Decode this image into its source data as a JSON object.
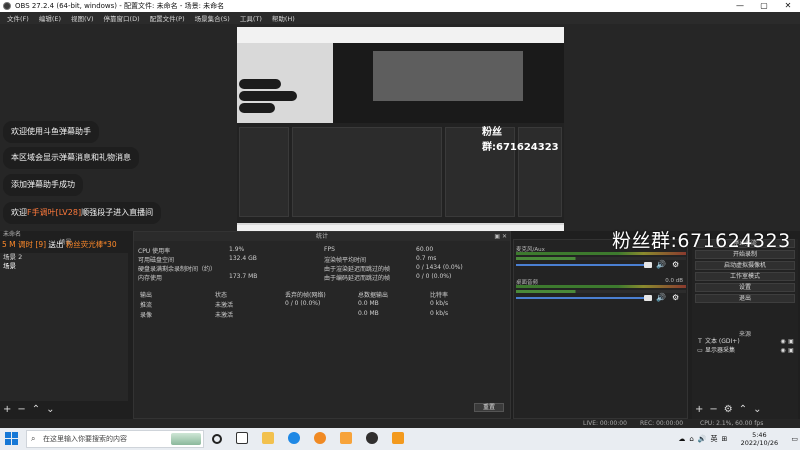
{
  "window": {
    "title": "OBS 27.2.4 (64-bit, windows) - 配置文件: 未命名 - 场景: 未命名",
    "controls": [
      "—",
      "▢",
      "✕"
    ]
  },
  "menu": [
    "文件(F)",
    "编辑(E)",
    "视图(V)",
    "停靠窗口(D)",
    "配置文件(P)",
    "场景集合(S)",
    "工具(T)",
    "帮助(H)"
  ],
  "preview": {
    "nested_fans": "粉丝群:671624323",
    "bubbles": [
      {
        "text": "欢迎使用斗鱼弹幕助手"
      },
      {
        "text": "本区域会显示弹幕消息和礼物消息"
      },
      {
        "text": "添加弹幕助手成功"
      },
      {
        "prefix": "欢迎",
        "name": "F手调叶[LV28]",
        "suffix": "顺强段子进入直播间"
      }
    ],
    "overlay": {
      "left": "5 M 调时 [9]",
      "mid": "送出",
      "right": "粉丝荧光棒*30"
    },
    "big_fans": "粉丝群:671624323"
  },
  "scenes": {
    "title": "场景",
    "tabs": [
      "未命名",
      "场景"
    ],
    "items": [
      "场景 2",
      "场景"
    ]
  },
  "stats": {
    "title": "统计",
    "rows_left": [
      {
        "label": "CPU 使用率",
        "value": "1.9%"
      },
      {
        "label": "可用磁盘空间",
        "value": "132.4 GB"
      },
      {
        "label": "硬盘录满剩余录制时间（约）",
        "value": ""
      },
      {
        "label": "内存使用",
        "value": "173.7 MB"
      }
    ],
    "rows_right": [
      {
        "label": "FPS",
        "value": "60.00"
      },
      {
        "label": "渲染帧平均时间",
        "value": "0.7 ms"
      },
      {
        "label": "由于渲染延迟而跳过的帧",
        "value": "0 / 1434 (0.0%)"
      },
      {
        "label": "由于编码延迟而跳过的帧",
        "value": "0 / 0 (0.0%)"
      }
    ],
    "columns": [
      "输出",
      "状态",
      "丢弃的帧(网络)",
      "总数据输出",
      "比特率"
    ],
    "outputs": [
      {
        "name": "推流",
        "status": "未激活",
        "dropped": "0 / 0 (0.0%)",
        "total": "0.0 MB",
        "bitrate": "0 kb/s"
      },
      {
        "name": "录像",
        "status": "未激活",
        "dropped": "",
        "total": "0.0 MB",
        "bitrate": "0 kb/s"
      }
    ],
    "reset": "重置"
  },
  "mixer": {
    "channels": [
      {
        "name": "麦克风/Aux",
        "db": "0.0 dB"
      },
      {
        "name": "桌面音频",
        "db": "0.0 dB"
      }
    ]
  },
  "controls": {
    "buttons": [
      "停止推流",
      "开始录制",
      "启动虚拟摄像机",
      "工作室模式",
      "设置",
      "退出"
    ],
    "sources_title": "来源",
    "sources": [
      {
        "name": "文本 (GDI+)",
        "icon": "T"
      },
      {
        "name": "显示器采集",
        "icon": "▭"
      }
    ]
  },
  "status": {
    "live": "LIVE: 00:00:00",
    "rec": "REC: 00:00:00",
    "cpu": "CPU: 2.1%, 60.00 fps"
  },
  "taskbar": {
    "search_placeholder": "在这里输入你要搜索的内容",
    "lang": "英",
    "time": "5:46",
    "date": "2022/10/26"
  }
}
